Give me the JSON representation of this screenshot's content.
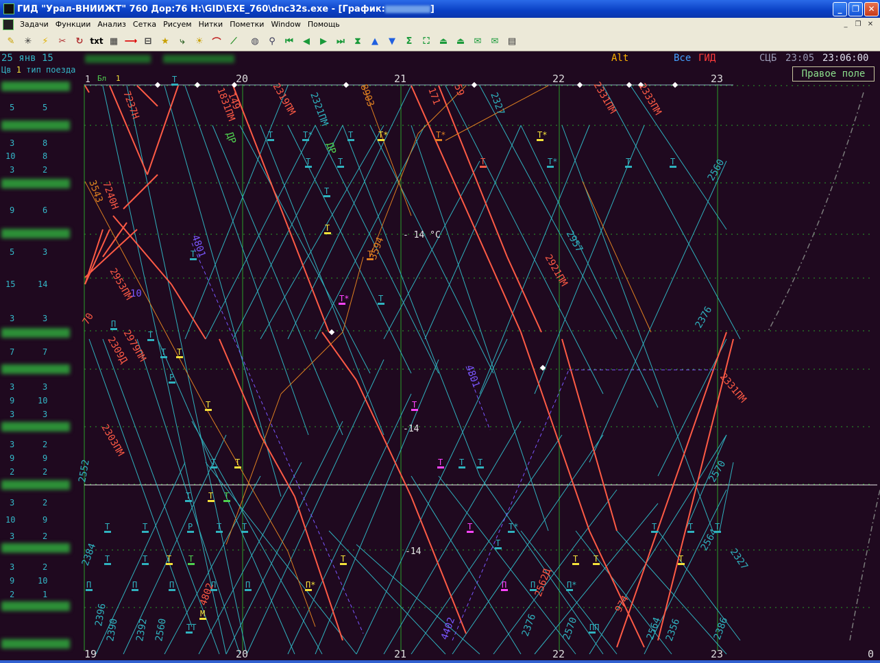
{
  "window": {
    "title_prefix": "ГИД \"Урал-ВНИИЖТ\" 760 Дор:76 H:\\GID\\EXE_760\\dnc32s.exe - [График:",
    "title_suffix": "]",
    "minimize": "_",
    "maximize": "❐",
    "close": "✕"
  },
  "menu": {
    "items": [
      "Задачи",
      "Функции",
      "Анализ",
      "Сетка",
      "Рисуем",
      "Нитки",
      "Пометки",
      "Window",
      "Помощь"
    ],
    "mdi_min": "_",
    "mdi_restore": "❐",
    "mdi_close": "✕"
  },
  "toolbar": {
    "txt_label": "txt",
    "icons": [
      "wand-icon",
      "star-burst-icon",
      "lightning-icon",
      "scissors-icon",
      "clock-arrow-icon",
      "txt",
      "table-icon",
      "red-arrow-icon",
      "line-cut-icon",
      "star-icon",
      "curve-icon",
      "sun-icon",
      "arc-icon",
      "green-line-icon",
      "globe-icon",
      "zoom-icon",
      "first-icon",
      "prev-icon",
      "next-icon",
      "last-icon",
      "hourglass-icon",
      "up-icon",
      "down-icon",
      "sum-icon",
      "fit-icon",
      "stamp1-icon",
      "stamp2-icon",
      "note1-icon",
      "note2-icon",
      "doc-icon"
    ]
  },
  "header": {
    "date": "25 янв 15",
    "alt": "Alt",
    "all": "Все",
    "gid": "ГИД",
    "tz": "СЦБ",
    "time_left": "23:05",
    "time_right": "23:06:00",
    "sub_left": "Цв",
    "sub_one": "1",
    "sub_text": "тип поезда",
    "bl_label": "Бл",
    "bl_value": "1",
    "right_field": "Правое поле"
  },
  "colors": {
    "background": "#1f091f",
    "cyan": "#2fb2bf",
    "red": "#ff5b45",
    "orange": "#e08020",
    "purple": "#7a57ff",
    "green_grid": "#2aa02a",
    "yellow": "#f5e23a"
  },
  "timeline": {
    "hours_top": [
      "20",
      "21",
      "22",
      "23"
    ],
    "hours_bottom": [
      "19",
      "20",
      "21",
      "22",
      "23",
      "0"
    ],
    "left_top_mark": "1"
  },
  "stations": {
    "numbers": [
      [
        "5",
        "5"
      ],
      [
        "3",
        "8"
      ],
      [
        "10",
        "8"
      ],
      [
        "3",
        "2"
      ],
      [
        "9",
        "6"
      ],
      [
        "5",
        "3"
      ],
      [
        "15",
        "14"
      ],
      [
        "3",
        "3"
      ],
      [
        "7",
        "7"
      ],
      [
        "3",
        "3"
      ],
      [
        "9",
        "10"
      ],
      [
        "3",
        "3"
      ],
      [
        "3",
        "2"
      ],
      [
        "9",
        "9"
      ],
      [
        "2",
        "2"
      ],
      [
        "3",
        "2"
      ],
      [
        "10",
        "9"
      ],
      [
        "3",
        "2"
      ],
      [
        "3",
        "2"
      ],
      [
        "9",
        "10"
      ],
      [
        "2",
        "1"
      ]
    ]
  },
  "annotations": {
    "temp1": "- 14 °C",
    "temp2": "-14",
    "temp3": "-14"
  },
  "train_labels": {
    "red": [
      "7237Н",
      "7240Н",
      "1831ПМ",
      "149",
      "2319ПМ",
      "171",
      "59",
      "2331ПМ",
      "2333ПМ",
      "2921ПМ",
      "2331ПМ",
      "2979ПМ",
      "2309Д",
      "2303ПМ",
      "2953ПМ",
      "70",
      "2562Д",
      "4802",
      "974"
    ],
    "cyan": [
      "2321ПМ",
      "2327",
      "2560",
      "2957",
      "2376",
      "2570",
      "2552",
      "2384",
      "2396",
      "2390",
      "2392",
      "2560",
      "2376",
      "2570",
      "2564",
      "2356",
      "2386",
      "2327",
      "2564"
    ],
    "orange": [
      "3543",
      "8903",
      "3594"
    ],
    "purple": [
      "4801",
      "4801",
      "4402",
      "10"
    ],
    "green": [
      "ДР",
      "ДР"
    ]
  },
  "markers": {
    "T": "Т",
    "Tstar": "Т*",
    "P": "П",
    "Pstar": "П*",
    "R": "Р",
    "M": "М",
    "PP": "ПП",
    "TT": "ТТ"
  }
}
